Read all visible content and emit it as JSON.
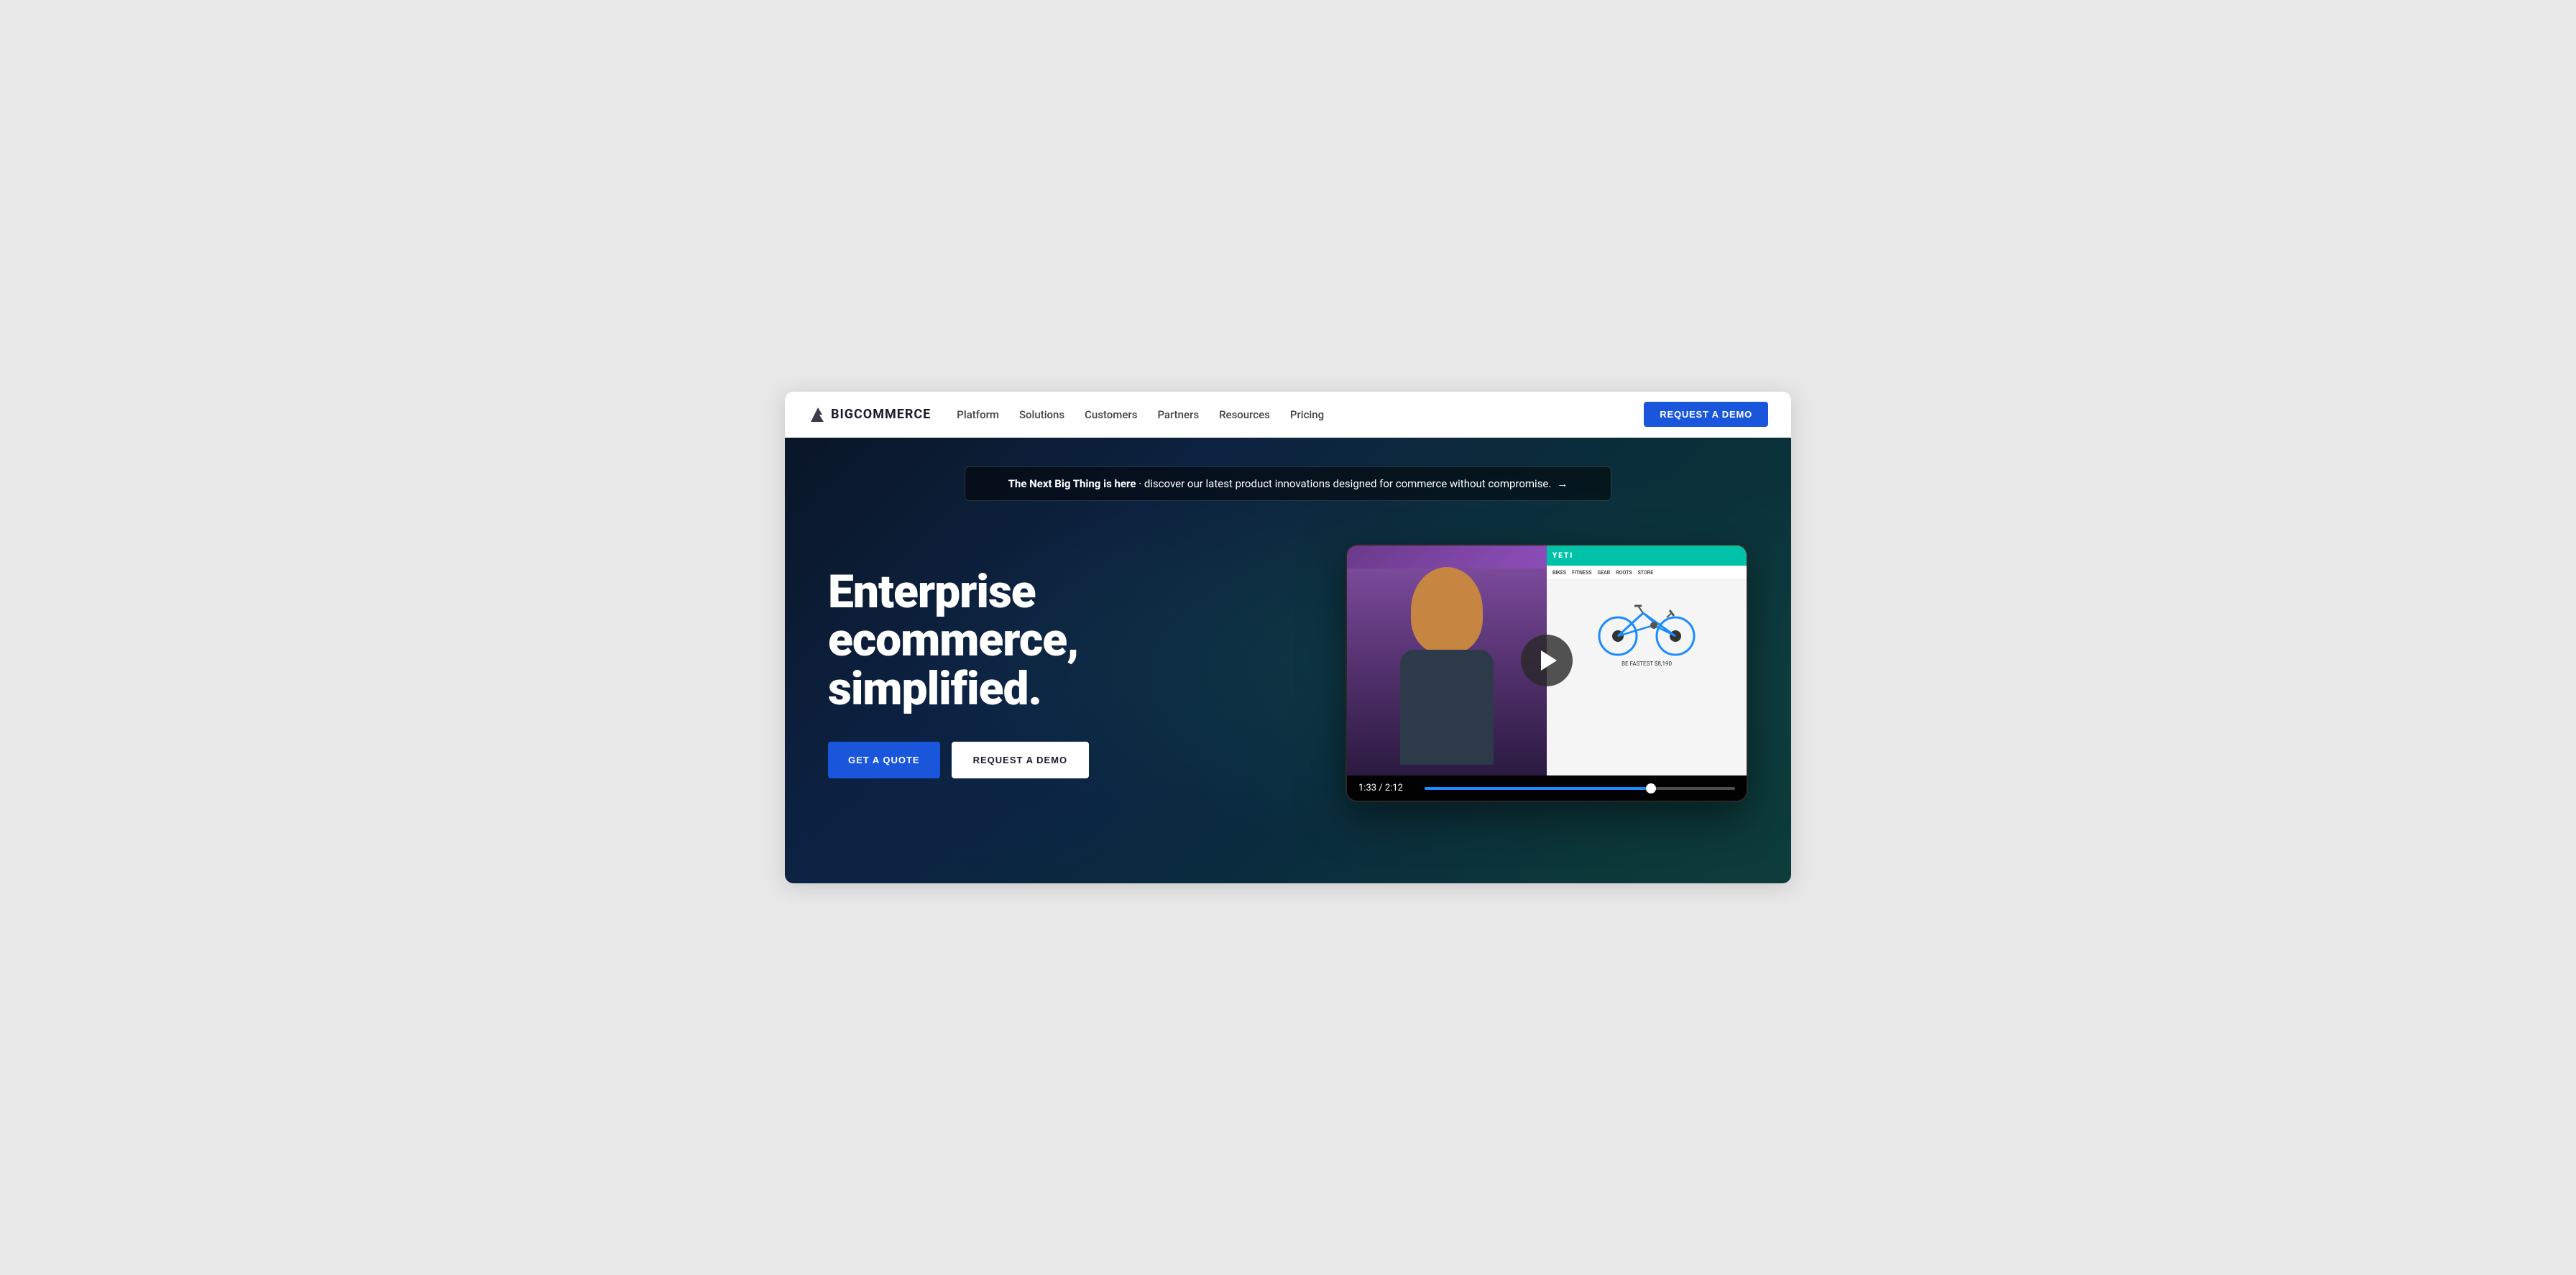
{
  "nav": {
    "logo_text": "BIGCOMMERCE",
    "links": [
      {
        "id": "platform",
        "label": "Platform"
      },
      {
        "id": "solutions",
        "label": "Solutions"
      },
      {
        "id": "customers",
        "label": "Customers"
      },
      {
        "id": "partners",
        "label": "Partners"
      },
      {
        "id": "resources",
        "label": "Resources"
      },
      {
        "id": "pricing",
        "label": "Pricing"
      }
    ],
    "cta_label": "REQUEST A DEMO"
  },
  "announcement": {
    "bold_text": "The Next Big Thing is here",
    "rest_text": " · discover our latest product innovations designed for commerce without compromise.",
    "arrow": "→"
  },
  "hero": {
    "title": "Enterprise ecommerce, simplified.",
    "btn_quote": "GET A QUOTE",
    "btn_demo": "REQUEST A DEMO"
  },
  "video": {
    "time_current": "1:33",
    "time_total": "2:12",
    "time_display": "1:33 / 2:12",
    "progress_percent": 73,
    "yeti_logo": "YETI",
    "bike_price": "BE FASTEST $8,190",
    "nav_items": [
      "BIKES",
      "FITNESS",
      "GEAR",
      "ROOTS",
      "STORE"
    ]
  }
}
